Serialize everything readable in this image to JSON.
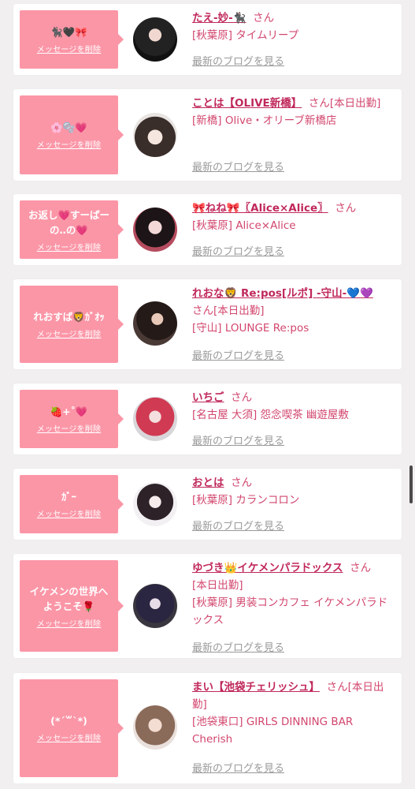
{
  "colors": {
    "accent": "#fb96a7",
    "name": "#c0285c",
    "text": "#d2466e"
  },
  "delete_label": "メッセージを削除",
  "blog_label": "最新のブログを見る",
  "san": "さん",
  "cards": [
    {
      "msg": "🐈‍⬛🖤🎀",
      "name": "たえ-妙-🐈‍⬛",
      "status": "",
      "shop": "[秋葉原] タイムリープ"
    },
    {
      "msg": "🌸🫧💗",
      "name": "ことは【OLIVE新橋】",
      "status": "[本日出勤]",
      "shop": "[新橋] Olive・オリーブ新橋店"
    },
    {
      "msg": "お返し💗すーぱーの‥の💗",
      "name": "🎀ねね🎀〖Alice×Alice〗",
      "status": "",
      "shop": "[秋葉原] Alice×Alice"
    },
    {
      "msg": "れおすば🦁ｶﾞｵｯ",
      "name": "れおな🦁 Re:pos[ルポ] -守山-💙💜",
      "status": "[本日出勤]",
      "shop": "[守山] LOUNGE Re:pos"
    },
    {
      "msg": "🍓+˚💗",
      "name": "いちご",
      "status": "",
      "shop": "[名古屋 大須] 怨念喫茶 幽遊屋敷"
    },
    {
      "msg": "ｶﾞｰ",
      "name": "おとは",
      "status": "",
      "shop": "[秋葉原] カランコロン"
    },
    {
      "msg": "イケメンの世界へようこそ🌹",
      "name": "ゆづき👑イケメンパラドックス",
      "status": "[本日出勤]",
      "shop": "[秋葉原] 男装コンカフェ イケメンパラドックス"
    },
    {
      "msg": "(*´꒳`*)",
      "name": "まい【池袋チェリッシュ】",
      "status": "[本日出勤]",
      "shop": "[池袋東口] GIRLS DINNING BAR Cherish"
    }
  ]
}
